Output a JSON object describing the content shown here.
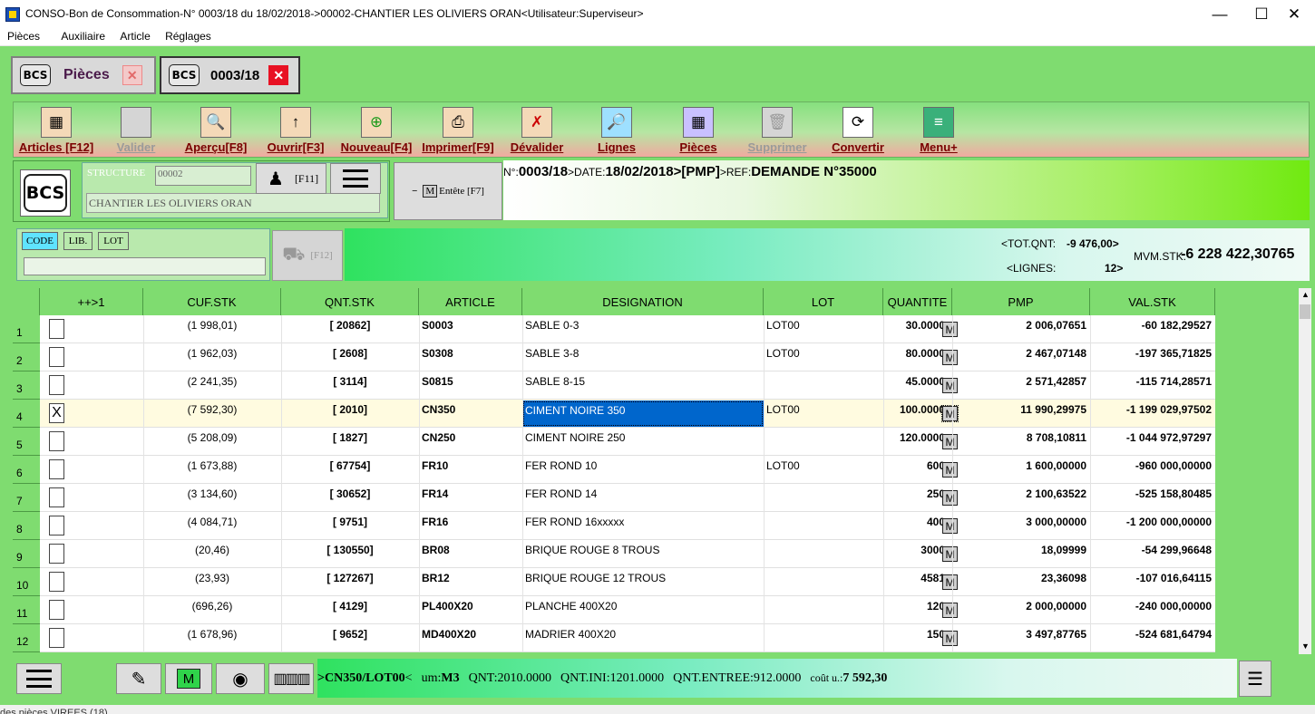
{
  "window": {
    "title": "CONSO-Bon de Consommation-N° 0003/18 du 18/02/2018->00002-CHANTIER LES OLIVIERS ORAN<Utilisateur:Superviseur>",
    "minimize": "—",
    "maximize": "☐",
    "close": "✕"
  },
  "menu": [
    "Pièces",
    "Auxiliaire",
    "Article",
    "Réglages"
  ],
  "doc_tabs": [
    {
      "icon": "BCS",
      "label": "Pièces",
      "close": "✕"
    },
    {
      "icon": "BCS",
      "label": "0003/18",
      "close": "✕"
    }
  ],
  "toolbar": [
    {
      "label": "Articles [F12]",
      "icon": "grid-icon",
      "enabled": true
    },
    {
      "label": "Valider",
      "icon": "validate-icon",
      "enabled": false
    },
    {
      "label": "Aperçu[F8]",
      "icon": "preview-icon",
      "enabled": true
    },
    {
      "label": "Ouvrir[F3]",
      "icon": "open-icon",
      "enabled": true
    },
    {
      "label": "Nouveau[F4]",
      "icon": "new-icon",
      "enabled": true
    },
    {
      "label": "Imprimer[F9]",
      "icon": "printer-icon",
      "enabled": true
    },
    {
      "label": "Dévalider",
      "icon": "unvalidate-icon",
      "enabled": true
    },
    {
      "label": "Lignes",
      "icon": "magnifier-icon",
      "enabled": true
    },
    {
      "label": "Pièces",
      "icon": "pieces-icon",
      "enabled": true
    },
    {
      "label": "Supprimer",
      "icon": "delete-icon",
      "enabled": false
    },
    {
      "label": "Convertir",
      "icon": "convert-icon",
      "enabled": true
    },
    {
      "label": "Menu+",
      "icon": "menu-icon",
      "enabled": true
    }
  ],
  "header": {
    "bcs_label": "BCS",
    "structure_label": "STRUCTURE",
    "structure_code": "00002",
    "structure_name": "CHANTIER LES OLIVIERS ORAN",
    "user_key": "[F11]",
    "entete_toggle": "−",
    "entete_m": "M",
    "entete_label": "Entête [F7]",
    "doc_prefix1": "N°:",
    "doc_number": "0003/18",
    "doc_prefix2": ">DATE:",
    "doc_date": "18/02/2018",
    "doc_type": ">[PMP]",
    "doc_prefix3": ">REF:",
    "doc_ref": "DEMANDE N°35000"
  },
  "search": {
    "tabs": [
      "CODE",
      "LIB.",
      "LOT"
    ],
    "value": "",
    "cart_key": "[F12]"
  },
  "totals": {
    "tot_qnt_label": "<TOT.QNT:",
    "tot_qnt_value": "-9 476,00>",
    "lignes_label": "<LIGNES:",
    "lignes_value": "12>",
    "mvm_label": "MVM.STK:",
    "mvm_value": "-6 228 422,30765"
  },
  "grid": {
    "columns": [
      "++>1",
      "CUF.STK",
      "QNT.STK",
      "ARTICLE",
      "DESIGNATION",
      "LOT",
      "QUANTITE",
      "PMP",
      "VAL.STK"
    ],
    "selected_row": 4,
    "rows": [
      {
        "n": "1",
        "checked": "",
        "cuf": "(1 998,01)",
        "qnt": "[ 20862]",
        "article": "S0003",
        "designation": "SABLE 0-3",
        "lot": "LOT00",
        "quantite": "30.0000",
        "m": "M",
        "pmp": "2 006,07651",
        "val": "-60 182,29527"
      },
      {
        "n": "2",
        "checked": "",
        "cuf": "(1 962,03)",
        "qnt": "[ 2608]",
        "article": "S0308",
        "designation": "SABLE 3-8",
        "lot": "LOT00",
        "quantite": "80.0000",
        "m": "M",
        "pmp": "2 467,07148",
        "val": "-197 365,71825"
      },
      {
        "n": "3",
        "checked": "",
        "cuf": "(2 241,35)",
        "qnt": "[ 3114]",
        "article": "S0815",
        "designation": "SABLE 8-15",
        "lot": "",
        "quantite": "45.0000",
        "m": "M",
        "pmp": "2 571,42857",
        "val": "-115 714,28571"
      },
      {
        "n": "4",
        "checked": "X",
        "cuf": "(7 592,30)",
        "qnt": "[ 2010]",
        "article": "CN350",
        "designation": "CIMENT NOIRE 350",
        "lot": "LOT00",
        "quantite": "100.0000",
        "m": "M",
        "pmp": "11 990,29975",
        "val": "-1 199 029,97502"
      },
      {
        "n": "5",
        "checked": "",
        "cuf": "(5 208,09)",
        "qnt": "[ 1827]",
        "article": "CN250",
        "designation": "CIMENT NOIRE 250",
        "lot": "",
        "quantite": "120.0000",
        "m": "M",
        "pmp": "8 708,10811",
        "val": "-1 044 972,97297"
      },
      {
        "n": "6",
        "checked": "",
        "cuf": "(1 673,88)",
        "qnt": "[ 67754]",
        "article": "FR10",
        "designation": "FER ROND 10",
        "lot": "LOT00",
        "quantite": "600",
        "m": "M",
        "pmp": "1 600,00000",
        "val": "-960 000,00000"
      },
      {
        "n": "7",
        "checked": "",
        "cuf": "(3 134,60)",
        "qnt": "[ 30652]",
        "article": "FR14",
        "designation": "FER ROND 14",
        "lot": "",
        "quantite": "250",
        "m": "M",
        "pmp": "2 100,63522",
        "val": "-525 158,80485"
      },
      {
        "n": "8",
        "checked": "",
        "cuf": "(4 084,71)",
        "qnt": "[ 9751]",
        "article": "FR16",
        "designation": "FER ROND 16xxxxx",
        "lot": "",
        "quantite": "400",
        "m": "M",
        "pmp": "3 000,00000",
        "val": "-1 200 000,00000"
      },
      {
        "n": "9",
        "checked": "",
        "cuf": "(20,46)",
        "qnt": "[ 130550]",
        "article": "BR08",
        "designation": "BRIQUE ROUGE 8 TROUS",
        "lot": "",
        "quantite": "3000",
        "m": "M",
        "pmp": "18,09999",
        "val": "-54 299,96648"
      },
      {
        "n": "10",
        "checked": "",
        "cuf": "(23,93)",
        "qnt": "[ 127267]",
        "article": "BR12",
        "designation": "BRIQUE ROUGE 12 TROUS",
        "lot": "",
        "quantite": "4581",
        "m": "M",
        "pmp": "23,36098",
        "val": "-107 016,64115"
      },
      {
        "n": "11",
        "checked": "",
        "cuf": "(696,26)",
        "qnt": "[ 4129]",
        "article": "PL400X20",
        "designation": "PLANCHE 400X20",
        "lot": "",
        "quantite": "120",
        "m": "M",
        "pmp": "2 000,00000",
        "val": "-240 000,00000"
      },
      {
        "n": "12",
        "checked": "",
        "cuf": "(1 678,96)",
        "qnt": "[ 9652]",
        "article": "MD400X20",
        "designation": "MADRIER 400X20",
        "lot": "",
        "quantite": "150",
        "m": "M",
        "pmp": "3 497,87765",
        "val": "-524 681,64794"
      }
    ]
  },
  "bottom": {
    "m_label": "M",
    "status_prefix": ">",
    "status_item": "CN350/LOT00",
    "status_lt": "<",
    "um_label": "um:",
    "um_value": "M3",
    "qnt_label": "QNT:",
    "qnt_value": "2010.0000",
    "qnt_ini_label": "QNT.INI:",
    "qnt_ini_value": "1201.0000",
    "qnt_entree_label": "QNT.ENTREE:",
    "qnt_entree_value": "912.0000",
    "cout_label": "coût u.:",
    "cout_value": "7 592,30"
  },
  "footer_text": "des pièces VIREES (18)",
  "colors": {
    "green": "#7fdc70",
    "selection": "#0066cc",
    "close_red": "#e81123"
  }
}
